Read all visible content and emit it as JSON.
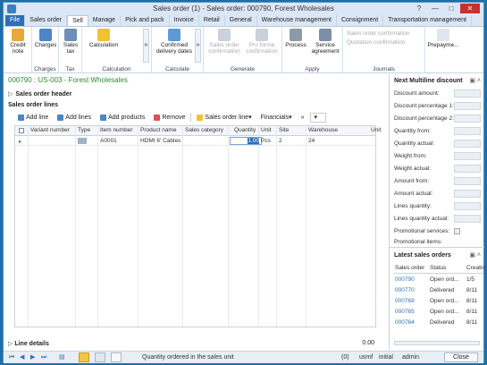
{
  "window": {
    "title": "Sales order (1) - Sales order: 000790, Forest Wholesales"
  },
  "tabs": [
    "File",
    "Sales order",
    "Sell",
    "Manage",
    "Pick and pack",
    "Invoice",
    "Retail",
    "General",
    "Warehouse management",
    "Consignment",
    "Transportation management"
  ],
  "ribbon": {
    "credit_note": "Credit note",
    "charges_group": "Charges",
    "charges": "Charges",
    "sales_tax": "Sales tax",
    "tax_group": "Tax",
    "calculation": "Calculation",
    "calculation_group": "Calculation",
    "confirmed_dates": "Confirmed delivery dates",
    "calculate_group": "Calculate",
    "sales_order_confirmation": "Sales order confirmation",
    "proforma_confirmation": "Pro forma confirmation",
    "generate_group": "Generate",
    "process": "Process",
    "service_agreement": "Service agreement",
    "apply_group": "Apply",
    "sales_order_confirmation_journal": "Sales order confirmation",
    "quotation_confirmation": "Quotation confirmation",
    "journals_group": "Journals",
    "prepayment": "Prepayme..."
  },
  "header": {
    "link": "000790 : US-003 - Forest Wholesales",
    "sales_order_header": "Sales order header",
    "sales_order_lines": "Sales order lines"
  },
  "toolbar": {
    "add_line": "Add line",
    "add_lines": "Add lines",
    "add_products": "Add products",
    "remove": "Remove",
    "sales_order_line": "Sales order line",
    "financials": "Financials"
  },
  "grid": {
    "columns": [
      "Variant number",
      "Type",
      "Item number",
      "Product name",
      "Sales category",
      "Quantity",
      "Unit",
      "Site",
      "Warehouse",
      "Unit"
    ],
    "rows": [
      {
        "item_number": "A0001",
        "product_name": "HDMI 6' Cables",
        "quantity": "1.00",
        "unit": "Pcs",
        "site": "2",
        "warehouse": "24"
      }
    ]
  },
  "line_details": {
    "label": "Line details",
    "value": "0.00"
  },
  "factbox": {
    "title": "Next Multiline discount",
    "fields": [
      "Discount amount:",
      "Discount percentage 1:",
      "Discount percentage 2:",
      "Quantity from:",
      "Quantity actual:",
      "Weight from:",
      "Weight actual:",
      "Amount from:",
      "Amount actual:",
      "Lines quantity:",
      "Lines quantity actual:",
      "Promotional services:",
      "Promotional items:"
    ],
    "orders_title": "Latest sales orders",
    "orders_columns": [
      "Sales order",
      "Status",
      "Creatio"
    ],
    "orders": [
      {
        "id": "000790",
        "status": "Open ord...",
        "created": "1/5"
      },
      {
        "id": "000770",
        "status": "Delivered",
        "created": "8/11"
      },
      {
        "id": "000769",
        "status": "Open ord...",
        "created": "8/11"
      },
      {
        "id": "000765",
        "status": "Open ord...",
        "created": "8/11"
      },
      {
        "id": "000764",
        "status": "Delivered",
        "created": "8/11"
      }
    ]
  },
  "status": {
    "text": "Quantity ordered in the sales unit",
    "count": "(0)",
    "company": "usmf",
    "partition": "initial",
    "user": "admin",
    "close": "Close"
  }
}
